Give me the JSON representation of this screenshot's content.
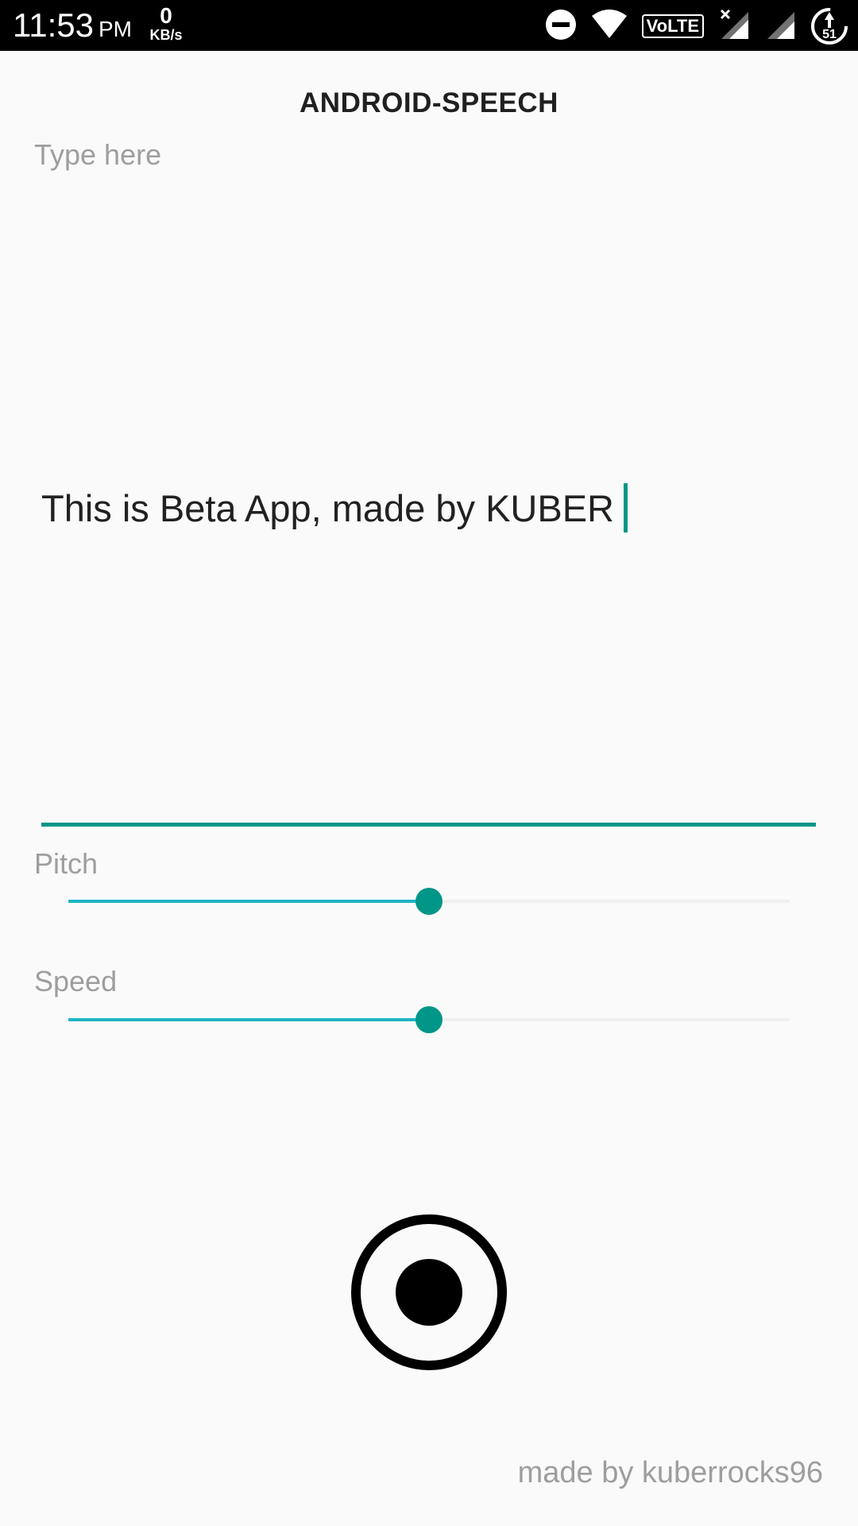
{
  "status_bar": {
    "time": "11:53",
    "ampm": "PM",
    "net_speed_value": "0",
    "net_speed_unit": "KB/s",
    "volte_label": "VoLTE",
    "battery_level": "51",
    "icons": [
      "do-not-disturb-icon",
      "wifi-icon",
      "volte-icon",
      "signal-no-data-icon",
      "signal-icon",
      "battery-charging-icon"
    ]
  },
  "app": {
    "title": "ANDROID-SPEECH",
    "input": {
      "placeholder": "Type here",
      "value": "This is Beta App, made by KUBER"
    },
    "pitch": {
      "label": "Pitch",
      "value_fraction": 0.5
    },
    "speed": {
      "label": "Speed",
      "value_fraction": 0.5
    },
    "record_icon": "record-icon",
    "footer": "made by kuberrocks96"
  },
  "colors": {
    "accent": "#009688",
    "slider_fill": "#1eb4c4",
    "hint_text": "#9e9e9e",
    "status_bar": "#000000",
    "background": "#fafafa"
  }
}
